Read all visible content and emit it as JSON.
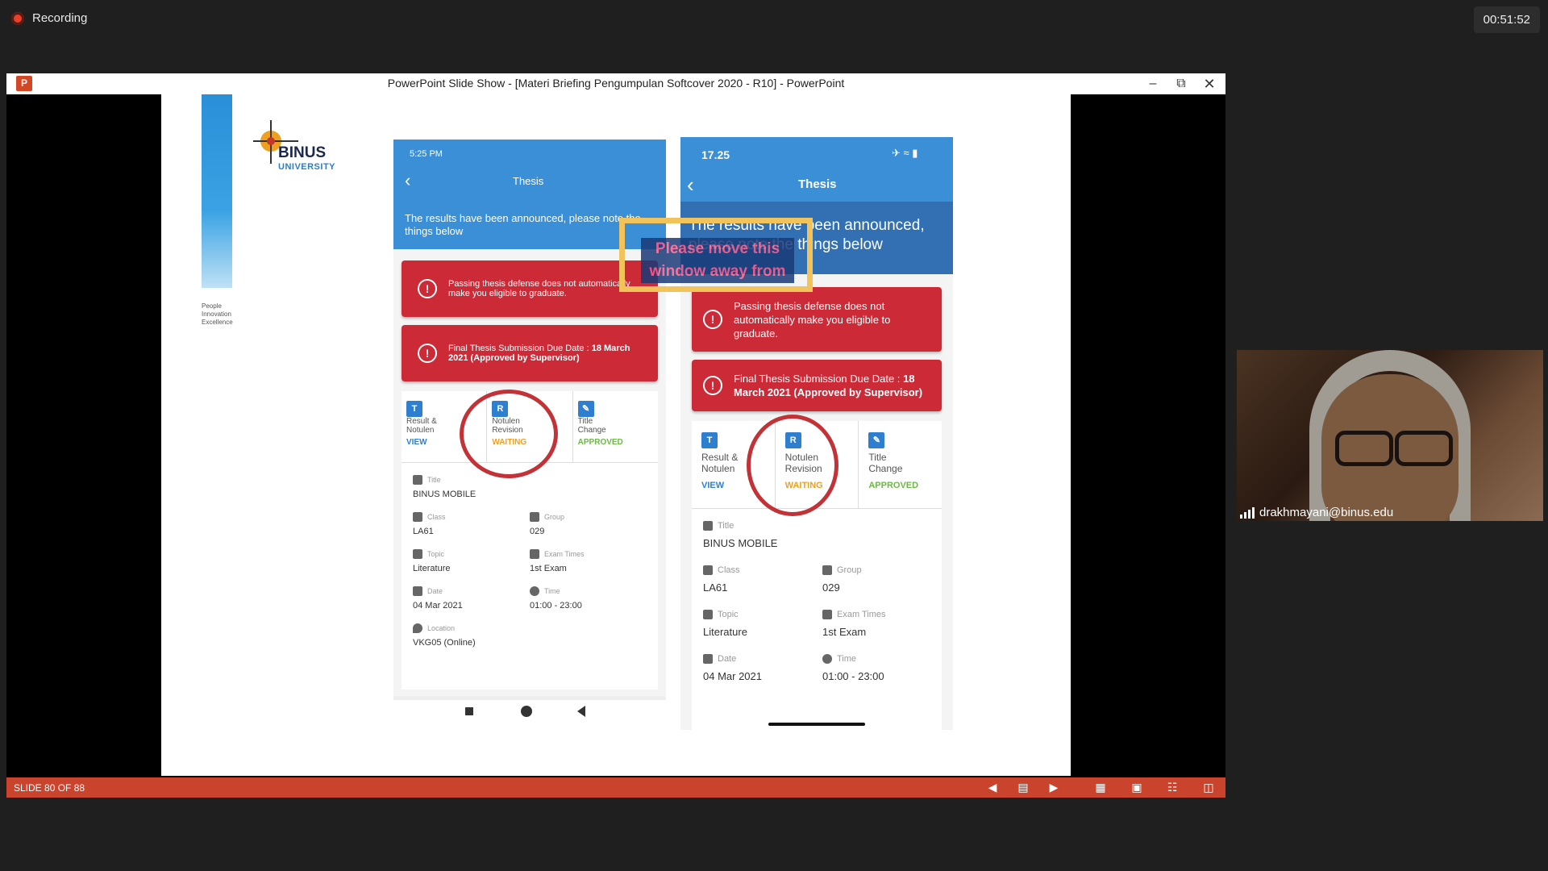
{
  "recording": {
    "label": "Recording",
    "timer": "00:51:52"
  },
  "window": {
    "title": "PowerPoint Slide Show - [Materi Briefing Pengumpulan Softcover 2020 - R10] - PowerPoint",
    "app_icon": "P"
  },
  "statusbar": {
    "slide_indicator": "SLIDE 80 OF 88"
  },
  "slide": {
    "logo": {
      "name": "BINUS",
      "sub": "UNIVERSITY"
    },
    "tagline": [
      "People",
      "Innovation",
      "Excellence"
    ]
  },
  "overlay": {
    "text": "Please move this window away from"
  },
  "phone_left": {
    "time": "5:25 PM",
    "title": "Thesis",
    "banner": "The results have been announced, please note the things below",
    "alert1": "Passing thesis defense does not automatically make you eligible to graduate.",
    "alert2_prefix": "Final Thesis Submission Due Date : ",
    "alert2_bold": "18 March 2021 (Approved by Supervisor)",
    "tabs": [
      {
        "line1": "Result &",
        "line2": "Notulen",
        "status": "VIEW"
      },
      {
        "line1": "Notulen",
        "line2": "Revision",
        "status": "WAITING"
      },
      {
        "line1": "Title",
        "line2": "Change",
        "status": "APPROVED"
      }
    ],
    "fields": {
      "title_label": "Title",
      "title_value": "BINUS MOBILE",
      "class_label": "Class",
      "class_value": "LA61",
      "group_label": "Group",
      "group_value": "029",
      "topic_label": "Topic",
      "topic_value": "Literature",
      "exam_label": "Exam Times",
      "exam_value": "1st Exam",
      "date_label": "Date",
      "date_value": "04 Mar 2021",
      "time_label": "Time",
      "time_value": "01:00 - 23:00",
      "location_label": "Location",
      "location_value": "VKG05 (Online)"
    }
  },
  "phone_right": {
    "time": "17.25",
    "title": "Thesis",
    "banner": "The results have been announced, please note the things below",
    "alert1": "Passing thesis defense does not automatically make you eligible to graduate.",
    "alert2_prefix": "Final Thesis Submission Due Date : ",
    "alert2_bold": "18 March 2021 (Approved by Supervisor)",
    "tabs": [
      {
        "line1": "Result &",
        "line2": "Notulen",
        "status": "VIEW"
      },
      {
        "line1": "Notulen",
        "line2": "Revision",
        "status": "WAITING"
      },
      {
        "line1": "Title",
        "line2": "Change",
        "status": "APPROVED"
      }
    ],
    "fields": {
      "title_label": "Title",
      "title_value": "BINUS MOBILE",
      "class_label": "Class",
      "class_value": "LA61",
      "group_label": "Group",
      "group_value": "029",
      "topic_label": "Topic",
      "topic_value": "Literature",
      "exam_label": "Exam Times",
      "exam_value": "1st Exam",
      "date_label": "Date",
      "date_value": "04 Mar 2021",
      "time_label": "Time",
      "time_value": "01:00 - 23:00"
    }
  },
  "webcam": {
    "participant": "drakhmayani@binus.edu"
  }
}
